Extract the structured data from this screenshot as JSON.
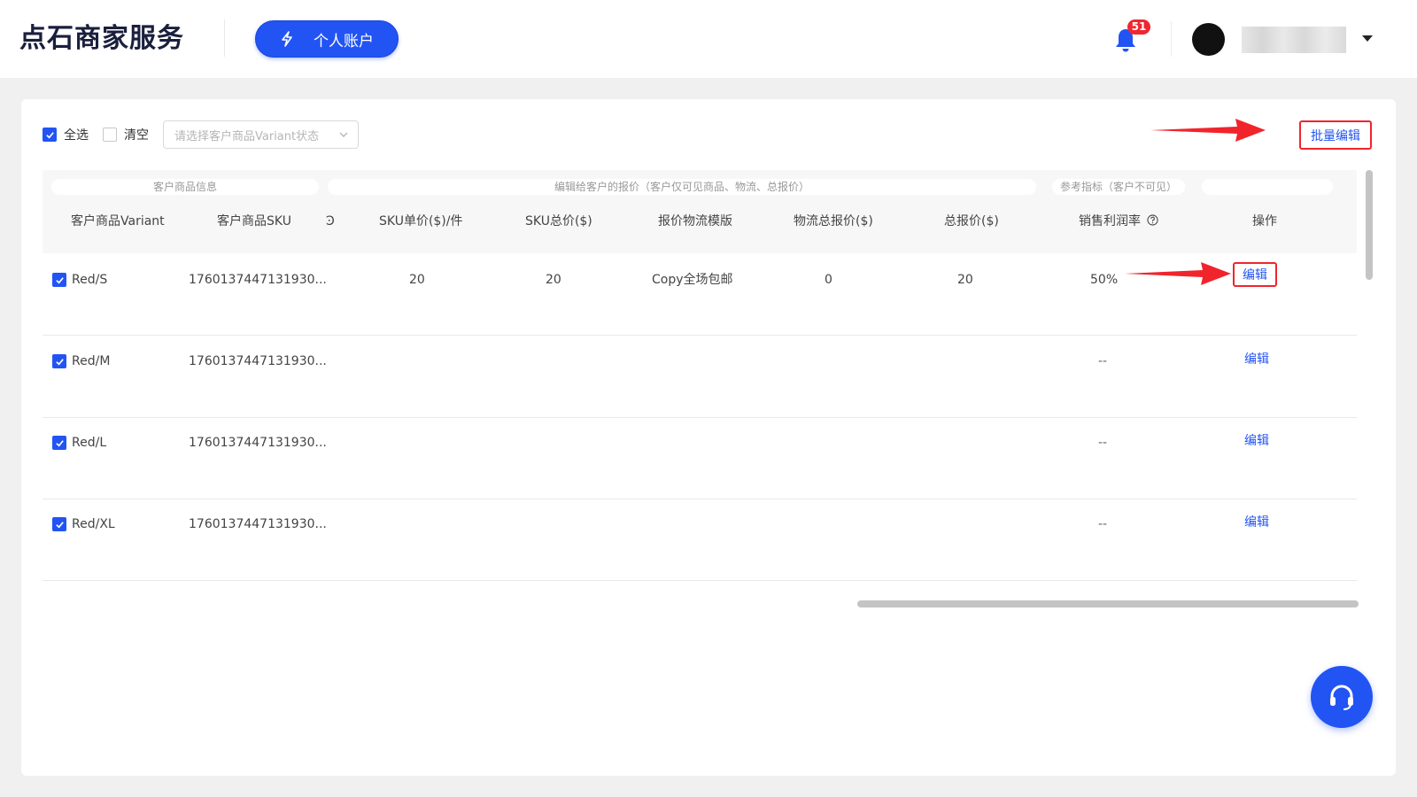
{
  "header": {
    "logo_text": "点石商家服务",
    "account_button_label": "个人账户",
    "notification_count": "51"
  },
  "toolbar": {
    "select_all_label": "全选",
    "clear_label": "清空",
    "variant_status_placeholder": "请选择客户商品Variant状态",
    "batch_edit_label": "批量编辑"
  },
  "table": {
    "groups": {
      "product_info": "客户商品信息",
      "quote": "编辑给客户的报价（客户仅可见商品、物流、总报价）",
      "reference": "参考指标（客户不可见）"
    },
    "columns": {
      "variant": "客户商品Variant",
      "sku": "客户商品SKU",
      "truncated": "Ͽ",
      "unit_price": "SKU单价($)/件",
      "sku_total": "SKU总价($)",
      "logistics_template": "报价物流模版",
      "logistics_total": "物流总报价($)",
      "total_quote": "总报价($)",
      "profit_margin": "销售利润率",
      "action": "操作"
    },
    "rows": [
      {
        "checked": true,
        "variant": "Red/S",
        "sku": "1760137447131930...",
        "unit_price": "20",
        "sku_total": "20",
        "logistics_template": "Copy全场包邮",
        "logistics_total": "0",
        "total_quote": "20",
        "profit_margin": "50%",
        "action": "编辑"
      },
      {
        "checked": true,
        "variant": "Red/M",
        "sku": "1760137447131930...",
        "profit_margin": "--",
        "action": "编辑"
      },
      {
        "checked": true,
        "variant": "Red/L",
        "sku": "1760137447131930...",
        "profit_margin": "--",
        "action": "编辑"
      },
      {
        "checked": true,
        "variant": "Red/XL",
        "sku": "1760137447131930...",
        "profit_margin": "--",
        "action": "编辑"
      }
    ]
  },
  "colors": {
    "primary": "#2254f4",
    "annotation_red": "#f1242c",
    "badge_red": "#f0262f"
  }
}
